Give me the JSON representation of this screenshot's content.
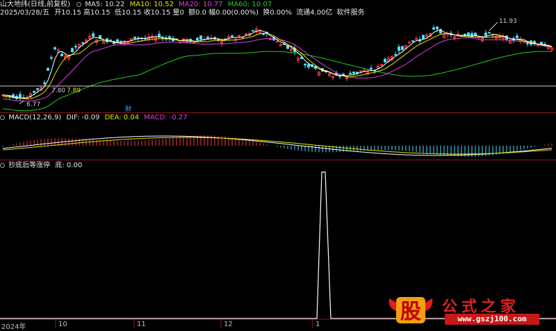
{
  "header": {
    "stock_name": "山大地纬(日线,前复权)",
    "ma5": "MA5: 10.22",
    "ma10": "MA10: 10.52",
    "ma20": "MA20: 10.77",
    "ma60": "MA60: 10.07"
  },
  "ohlc_line": {
    "date": "2025/03/28/五",
    "open": "开10.15",
    "high": "高10.15",
    "low": "低10.15",
    "close": "收10.15",
    "volume": "量0",
    "amount": "额0.0",
    "change": "幅0.00(0.00%)",
    "turnover": "换0.00%",
    "float": "流通4.00亿",
    "software": "软件服务"
  },
  "price_labels": {
    "high_mark": "11.93",
    "low_mark": "6.77",
    "cursor_a": "7.80",
    "cursor_b": "7.89",
    "finance_badge": "财"
  },
  "macd": {
    "title": "MACD(12,26,9)",
    "dif": "DIF: -0.09",
    "dea": "DEA: 0.04",
    "macd": "MACD: -0.27"
  },
  "indicator": {
    "title": "抄底后等涨停",
    "value": "底: 0.00"
  },
  "x_axis": {
    "year": "2024年",
    "m10": "10",
    "m11": "11",
    "m12": "12",
    "m1": "1"
  },
  "watermark": {
    "logo_char": "股",
    "site_name": "公式之家",
    "url": "www.gszj100.com"
  },
  "colors": {
    "up": "#ff3c3c",
    "down": "#4fe0ff",
    "ma5": "#ffffff",
    "ma10": "#e8e800",
    "ma20": "#e040e0",
    "ma60": "#20d020"
  }
}
